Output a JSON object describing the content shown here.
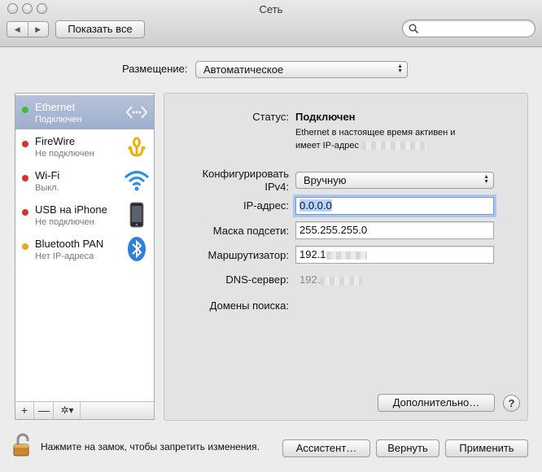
{
  "window": {
    "title": "Сеть"
  },
  "toolbar": {
    "back_label": "◀",
    "forward_label": "▶",
    "show_all_label": "Показать все",
    "search_placeholder": ""
  },
  "location": {
    "label": "Размещение:",
    "value": "Автоматическое"
  },
  "sidebar": {
    "services": [
      {
        "name": "Ethernet",
        "status": "Подключен",
        "status_color": "#3cbd3c",
        "icon": "ethernet-icon",
        "selected": true
      },
      {
        "name": "FireWire",
        "status": "Не подключен",
        "status_color": "#d9302c",
        "icon": "firewire-icon"
      },
      {
        "name": "Wi-Fi",
        "status": "Выкл.",
        "status_color": "#d9302c",
        "icon": "wifi-icon"
      },
      {
        "name": "USB на iPhone",
        "status": "Не подключен",
        "status_color": "#d9302c",
        "icon": "iphone-icon"
      },
      {
        "name": "Bluetooth PAN",
        "status": "Нет IP-адреса",
        "status_color": "#e9a817",
        "icon": "bluetooth-icon"
      }
    ],
    "add_label": "+",
    "remove_label": "—",
    "action_label": "✲▾"
  },
  "detail": {
    "status_label": "Статус:",
    "status_value": "Подключен",
    "status_desc_line1": "Ethernet в настоящее время активен и",
    "status_desc_line2": "имеет IP-адрес",
    "configure_label_line1": "Конфигурировать",
    "configure_label_line2": "IPv4:",
    "configure_value": "Вручную",
    "ip_label": "IP-адрес:",
    "ip_value": "0.0.0.0",
    "mask_label": "Маска подсети:",
    "mask_value": "255.255.255.0",
    "router_label": "Маршрутизатор:",
    "router_value": "192.1",
    "dns_label": "DNS-сервер:",
    "dns_value": "192.",
    "search_domains_label": "Домены поиска:",
    "advanced_label": "Дополнительно…",
    "help_label": "?"
  },
  "footer": {
    "lock_text": "Нажмите на замок, чтобы запретить изменения.",
    "assistant_label": "Ассистент…",
    "revert_label": "Вернуть",
    "apply_label": "Применить"
  }
}
